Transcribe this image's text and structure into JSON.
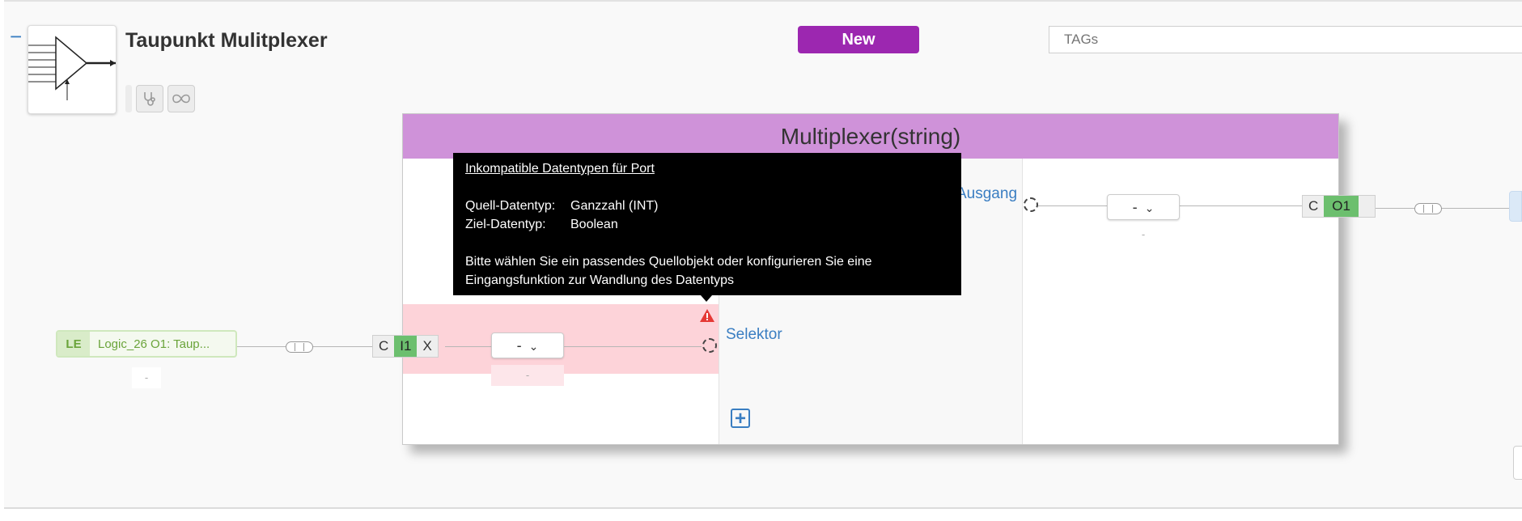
{
  "header": {
    "collapse_glyph": "−",
    "title": "Taupunkt Mulitplexer",
    "new_label": "New",
    "tags_placeholder": "TAGs"
  },
  "icons": {
    "logic_icon": "multiplexer-icon",
    "tool_1": "stethoscope-icon",
    "tool_2": "infinity-icon",
    "warning": "warning-triangle-icon",
    "add": "plus-icon"
  },
  "block": {
    "title": "Multiplexer(string)",
    "port_output": "Ausgang",
    "port_selector": "Selektor",
    "add_port_glyph": "+"
  },
  "tooltip": {
    "title": "Inkompatible Datentypen für Port",
    "source_key": "Quell-Datentyp:",
    "source_value": "Ganzzahl (INT)",
    "target_key": "Ziel-Datentyp:",
    "target_value": "Boolean",
    "message_line1": "Bitte wählen Sie ein passendes Quellobjekt oder konfigurieren Sie eine",
    "message_line2": "Eingangsfunktion zur Wandlung des Datentyps"
  },
  "input_port": {
    "c": "C",
    "id": "I1",
    "x": "X",
    "function": "-",
    "function_sub": "-"
  },
  "output_port": {
    "c": "C",
    "id": "O1",
    "function": "-",
    "function_sub": "-"
  },
  "source": {
    "tag": "LE",
    "label": "Logic_26 O1: Taup...",
    "sub": "-"
  },
  "colors": {
    "accent_purple": "#9c27b0",
    "block_header": "#cf92d9",
    "error_bg": "#fdd3d9",
    "port_green": "#6cbf6e",
    "link_blue": "#3a7ec2"
  }
}
